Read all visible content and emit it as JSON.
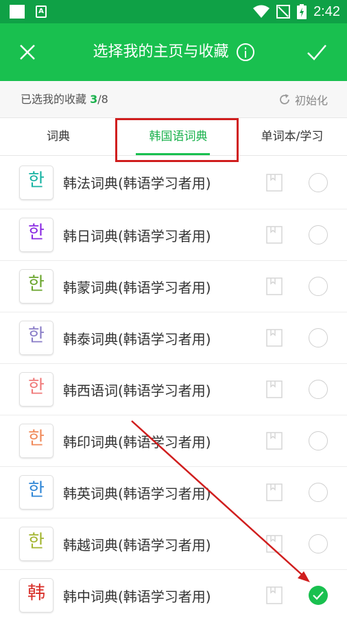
{
  "status_bar": {
    "time": "2:42",
    "icons": [
      "square-icon",
      "app-notification-icon",
      "wifi-icon",
      "no-signal-icon",
      "battery-charging-icon"
    ]
  },
  "header": {
    "title": "选择我的主页与收藏",
    "icons": {
      "close": "close-icon",
      "info": "info-icon",
      "confirm": "check-icon"
    },
    "background": "#19c04f"
  },
  "subbar": {
    "label": "已选我的收藏",
    "selected": "3",
    "separator": "/",
    "total": "8",
    "reset_label": "初始化"
  },
  "tabs": [
    {
      "label": "词典"
    },
    {
      "label": "韩国语词典",
      "active": true
    },
    {
      "label": "单词本/学习"
    }
  ],
  "items": [
    {
      "icon_text": "한",
      "icon_color": "#17b3a3",
      "label": "韩法词典(韩语学习者用)",
      "checked": false
    },
    {
      "icon_text": "한",
      "icon_color": "#8a2be2",
      "label": "韩日词典(韩语学习者用)",
      "checked": false
    },
    {
      "icon_text": "한",
      "icon_color": "#6aa52d",
      "label": "韩蒙词典(韩语学习者用)",
      "checked": false
    },
    {
      "icon_text": "한",
      "icon_color": "#8a7dc7",
      "label": "韩泰词典(韩语学习者用)",
      "checked": false
    },
    {
      "icon_text": "한",
      "icon_color": "#f07a7a",
      "label": "韩西语词(韩语学习者用)",
      "checked": false
    },
    {
      "icon_text": "한",
      "icon_color": "#f08a5a",
      "label": "韩印词典(韩语学习者用)",
      "checked": false
    },
    {
      "icon_text": "한",
      "icon_color": "#2f86d6",
      "label": "韩英词典(韩语学习者用)",
      "checked": false
    },
    {
      "icon_text": "한",
      "icon_color": "#a3b530",
      "label": "韩越词典(韩语学习者用)",
      "checked": false
    },
    {
      "icon_text": "韩",
      "icon_color": "#d8302a",
      "label": "韩中词典(韩语学习者用)",
      "checked": true
    }
  ],
  "colors": {
    "accent": "#19c04f",
    "annotation": "#d01e1e"
  }
}
